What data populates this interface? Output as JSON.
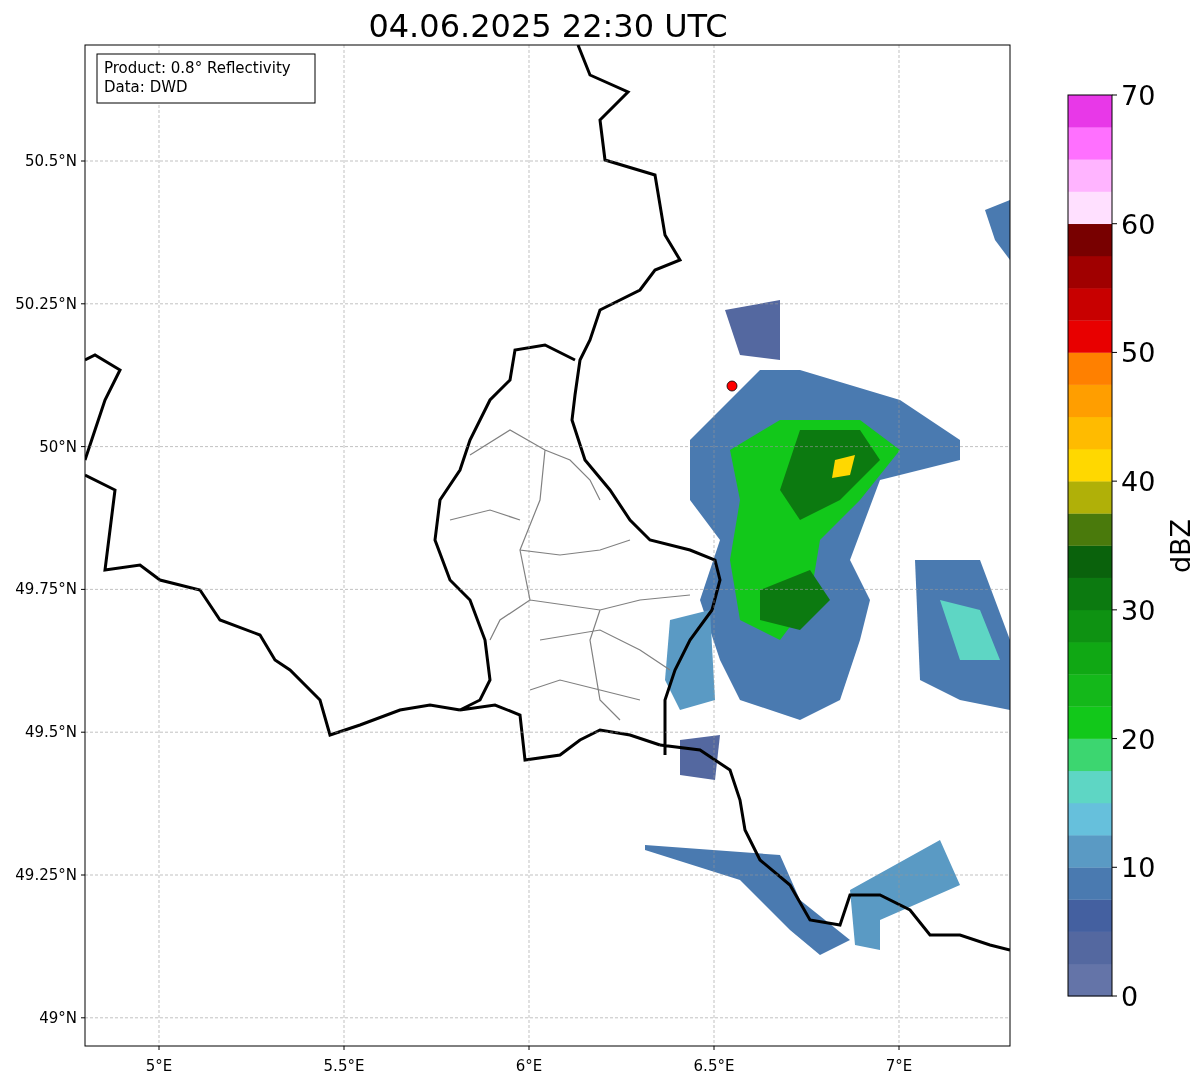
{
  "title": "04.06.2025 22:30 UTC",
  "annotation": [
    "Product: 0.8° Reflectivity",
    "Data: DWD"
  ],
  "map": {
    "xticks": [
      "5°E",
      "5.5°E",
      "6°E",
      "6.5°E",
      "7°E"
    ],
    "yticks": [
      "50.5°N",
      "50.25°N",
      "50°N",
      "49.75°N",
      "49.5°N",
      "49.25°N",
      "49°N"
    ]
  },
  "colorbar": {
    "label": "dBZ",
    "ticks": [
      "70",
      "60",
      "50",
      "40",
      "30",
      "20",
      "10",
      "0"
    ],
    "bands": [
      {
        "color": "#6474a8"
      },
      {
        "color": "#5468a0"
      },
      {
        "color": "#4460a0"
      },
      {
        "color": "#4a7ab0"
      },
      {
        "color": "#5a9ac4"
      },
      {
        "color": "#66c0dc"
      },
      {
        "color": "#5ed6c4"
      },
      {
        "color": "#3cd670"
      },
      {
        "color": "#12c81a"
      },
      {
        "color": "#14b81a"
      },
      {
        "color": "#10a814"
      },
      {
        "color": "#0e9212"
      },
      {
        "color": "#0c7a10"
      },
      {
        "color": "#0a620c"
      },
      {
        "color": "#4a7a0c"
      },
      {
        "color": "#b0b008"
      },
      {
        "color": "#ffd800"
      },
      {
        "color": "#ffbb00"
      },
      {
        "color": "#ff9e00"
      },
      {
        "color": "#ff8000"
      },
      {
        "color": "#e80000"
      },
      {
        "color": "#c80000"
      },
      {
        "color": "#a00000"
      },
      {
        "color": "#780000"
      },
      {
        "color": "#ffe0ff"
      },
      {
        "color": "#ffb4ff"
      },
      {
        "color": "#ff70ff"
      },
      {
        "color": "#e838e8"
      }
    ]
  }
}
